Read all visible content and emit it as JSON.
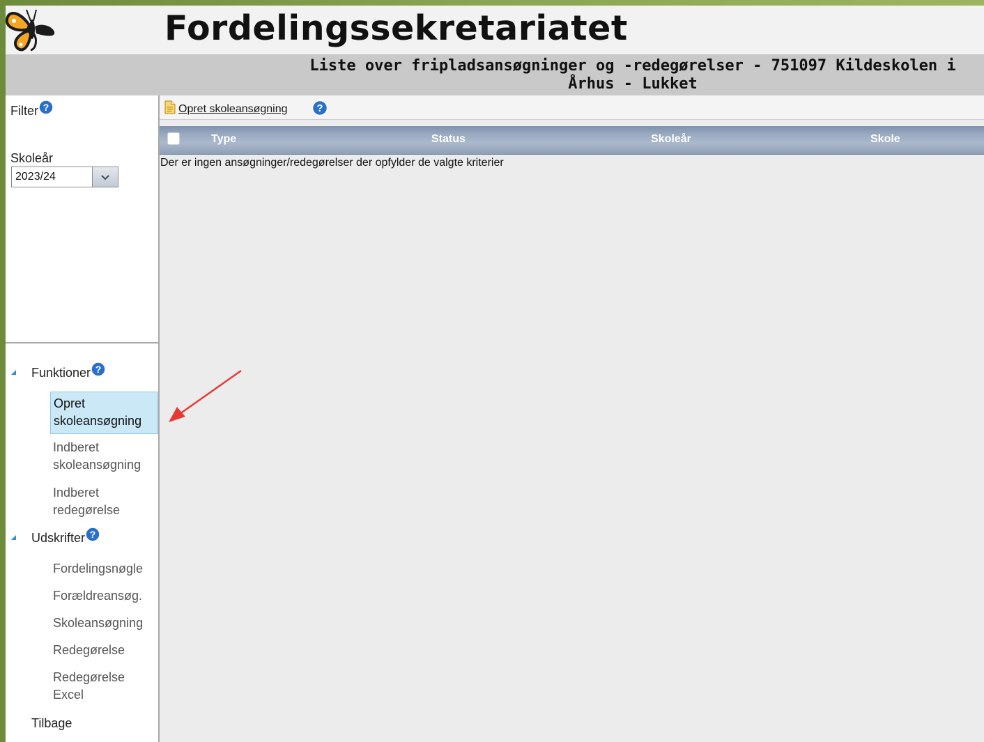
{
  "header": {
    "app_title": "Fordelingssekretariatet",
    "page_heading": "Liste over fripladsansøgninger og -redegørelser - 751097 Kildeskolen i Århus - Lukket"
  },
  "filter": {
    "title": "Filter",
    "skolear_label": "Skoleår",
    "skolear_value": "2023/24"
  },
  "nav": {
    "groups": [
      {
        "label": "Funktioner",
        "items": [
          {
            "label": "Opret skoleansøgning",
            "active": true
          },
          {
            "label": "Indberet skoleansøgning",
            "active": false
          },
          {
            "label": "Indberet redegørelse",
            "active": false
          }
        ]
      },
      {
        "label": "Udskrifter",
        "items": [
          {
            "label": "Fordelingsnøgle"
          },
          {
            "label": "Forældreansøg."
          },
          {
            "label": "Skoleansøgning"
          },
          {
            "label": "Redegørelse"
          },
          {
            "label": "Redegørelse Excel"
          }
        ]
      }
    ],
    "back_label": "Tilbage"
  },
  "toolbar": {
    "create_label": "Opret skoleansøgning"
  },
  "grid": {
    "columns": [
      "Type",
      "Status",
      "Skoleår",
      "Skole"
    ],
    "empty_message": "Der er ingen ansøgninger/redegørelser der opfylder de valgte kriterier"
  },
  "colors": {
    "outer_frame": "#7f9a45",
    "header_band": "#c9c9c9",
    "grid_header": "#9aaac0",
    "active_nav": "#cbe8f6",
    "help_icon": "#2a6fc9",
    "annotation_arrow": "#e53935"
  }
}
